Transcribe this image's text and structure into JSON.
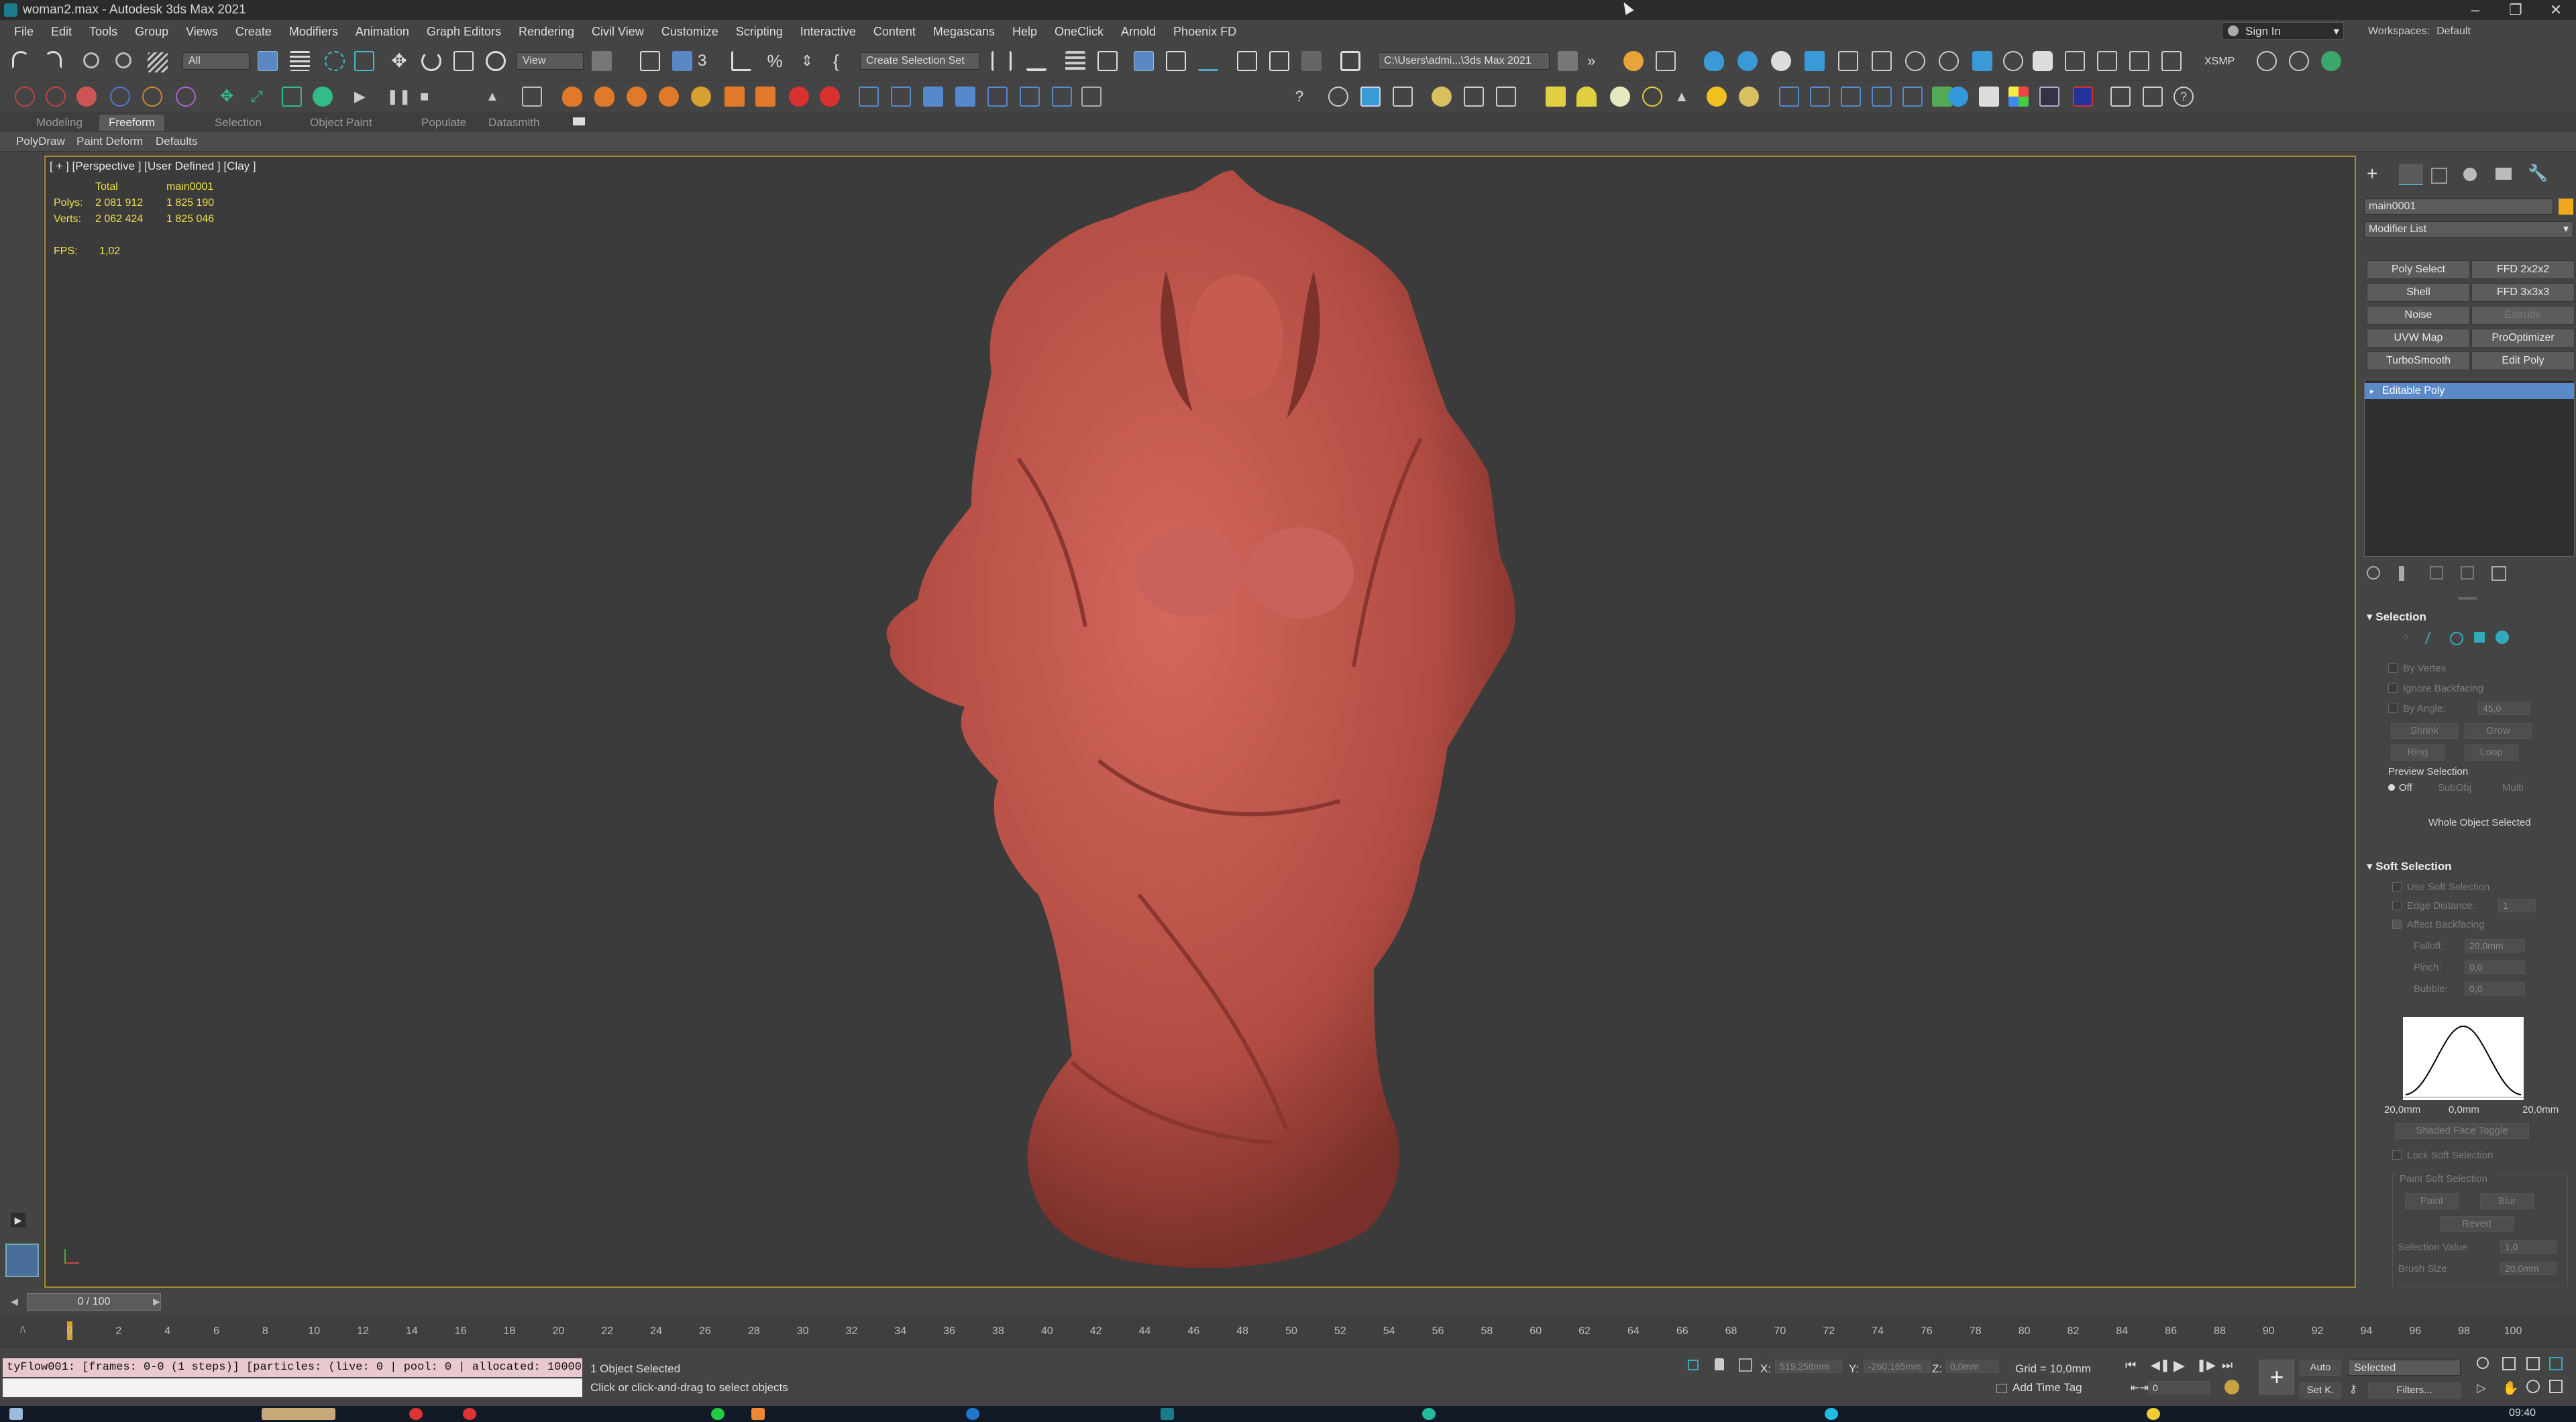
{
  "window": {
    "title": "woman2.max - Autodesk 3ds Max 2021"
  },
  "menu": [
    "File",
    "Edit",
    "Tools",
    "Group",
    "Views",
    "Create",
    "Modifiers",
    "Animation",
    "Graph Editors",
    "Rendering",
    "Civil View",
    "Customize",
    "Scripting",
    "Interactive",
    "Content",
    "Megascans",
    "Help",
    "OneClick",
    "Arnold",
    "Phoenix FD"
  ],
  "account": {
    "signin": "Sign In",
    "workspaces_label": "Workspaces:",
    "workspace": "Default"
  },
  "toolbar": {
    "filter": "All",
    "refcoord": "View",
    "selection_set": "Create Selection Set",
    "project_path": "C:\\Users\\admi...\\3ds Max 2021",
    "xsmp": "XSMP"
  },
  "ribbon": {
    "tabs": [
      "Modeling",
      "Freeform",
      "Selection",
      "Object Paint",
      "Populate",
      "Datasmith"
    ],
    "active_tab": "Freeform",
    "sub": [
      "PolyDraw",
      "Paint Deform",
      "Defaults"
    ]
  },
  "viewport": {
    "label": "[ + ] [Perspective ] [User Defined ] [Clay ]",
    "stats": {
      "header_total": "Total",
      "header_obj": "main0001",
      "polys_label": "Polys:",
      "polys_total": "2 081 912",
      "polys_obj": "1 825 190",
      "verts_label": "Verts:",
      "verts_total": "2 062 424",
      "verts_obj": "1 825 046",
      "fps_label": "FPS:",
      "fps": "1,02"
    },
    "model_color": "#c95a4f"
  },
  "command_panel": {
    "object_name": "main0001",
    "object_color": "#f0a81e",
    "modifier_list": "Modifier List",
    "modifier_buttons": [
      {
        "label": "Poly Select",
        "enabled": true
      },
      {
        "label": "FFD 2x2x2",
        "enabled": true
      },
      {
        "label": "Shell",
        "enabled": true
      },
      {
        "label": "FFD 3x3x3",
        "enabled": true
      },
      {
        "label": "Noise",
        "enabled": true
      },
      {
        "label": "Extrude",
        "enabled": false
      },
      {
        "label": "UVW Map",
        "enabled": true
      },
      {
        "label": "ProOptimizer",
        "enabled": true
      },
      {
        "label": "TurboSmooth",
        "enabled": true
      },
      {
        "label": "Edit Poly",
        "enabled": true
      }
    ],
    "stack_item": "Editable Poly",
    "selection": {
      "title": "Selection",
      "by_vertex": "By Vertex",
      "ignore_backfacing": "Ignore Backfacing",
      "by_angle": "By Angle:",
      "by_angle_value": "45,0",
      "shrink": "Shrink",
      "grow": "Grow",
      "ring": "Ring",
      "loop": "Loop",
      "preview_selection": "Preview Selection",
      "off": "Off",
      "subobj": "SubObj",
      "multi": "Multi",
      "whole_object": "Whole Object Selected"
    },
    "soft_selection": {
      "title": "Soft Selection",
      "use_soft": "Use Soft Selection",
      "edge_distance": "Edge Distance:",
      "edge_distance_value": "1",
      "affect_backfacing": "Affect Backfacing",
      "falloff": "Falloff:",
      "falloff_value": "20,0mm",
      "pinch": "Pinch:",
      "pinch_value": "0,0",
      "bubble": "Bubble:",
      "bubble_value": "0,0",
      "curve_left": "20,0mm",
      "curve_mid": "0,0mm",
      "curve_right": "20,0mm",
      "shaded_face_toggle": "Shaded Face Toggle",
      "lock_soft": "Lock Soft Selection",
      "paint_soft": "Paint Soft Selection",
      "paint": "Paint",
      "blur": "Blur",
      "revert": "Revert",
      "selection_value": "Selection Value",
      "selection_value_num": "1,0",
      "brush_size": "Brush Size",
      "brush_size_value": "20,0mm"
    }
  },
  "timeline": {
    "frame_display": "0 / 100",
    "ticks": [
      "0",
      "2",
      "4",
      "6",
      "8",
      "10",
      "12",
      "14",
      "16",
      "18",
      "20",
      "22",
      "24",
      "26",
      "28",
      "30",
      "32",
      "34",
      "36",
      "38",
      "40",
      "42",
      "44",
      "46",
      "48",
      "50",
      "52",
      "54",
      "56",
      "58",
      "60",
      "62",
      "64",
      "66",
      "68",
      "70",
      "72",
      "74",
      "76",
      "78",
      "80",
      "82",
      "84",
      "86",
      "88",
      "90",
      "92",
      "94",
      "96",
      "98",
      "100"
    ]
  },
  "status": {
    "listener": "tyFlow001: [frames: 0-0 (1 steps)] [particles: (live: 0 | pool: 0 | allocated: 100000",
    "selected": "1 Object Selected",
    "prompt": "Click or click-and-drag to select objects",
    "x_label": "X:",
    "x_value": "519,258mm",
    "y_label": "Y:",
    "y_value": "-260,165mm",
    "z_label": "Z:",
    "z_value": "0,0mm",
    "grid": "Grid = 10,0mm",
    "add_time_tag": "Add Time Tag",
    "auto": "Auto",
    "setk": "Set K.",
    "key_mode": "Selected",
    "filters": "Filters...",
    "frame_field": "0",
    "clock": "09:40"
  }
}
